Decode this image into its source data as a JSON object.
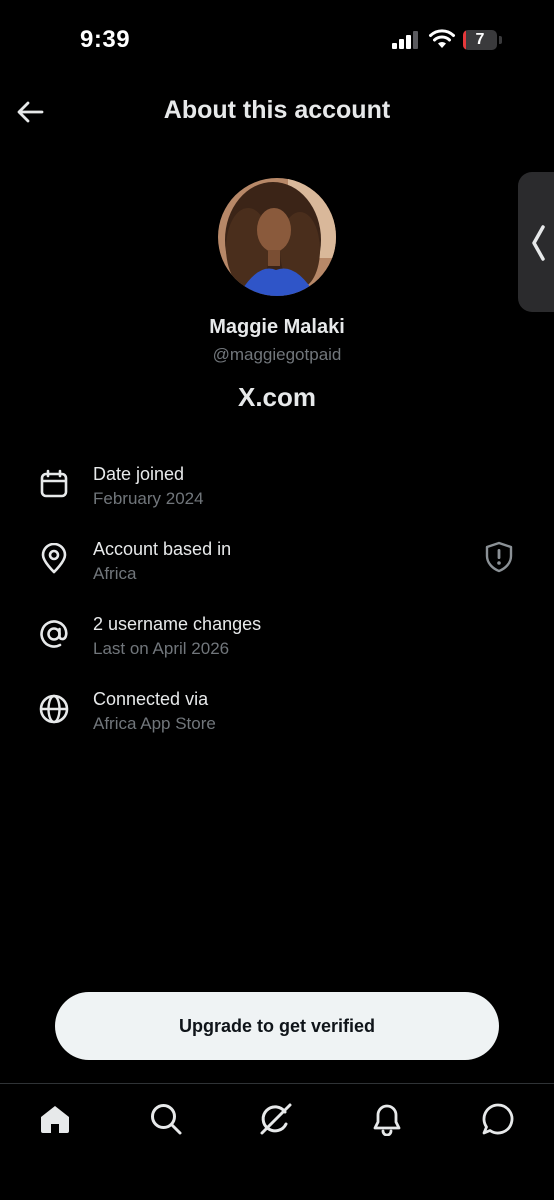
{
  "status_bar": {
    "time": "9:39",
    "battery_level": "7"
  },
  "header": {
    "title": "About this account"
  },
  "profile": {
    "display_name": "Maggie Malaki",
    "handle": "@maggiegotpaid",
    "platform": "X.com"
  },
  "info": [
    {
      "icon": "calendar-icon",
      "title": "Date joined",
      "subtitle": "February 2024"
    },
    {
      "icon": "location-pin-icon",
      "title": "Account based in",
      "subtitle": "Africa"
    },
    {
      "icon": "at-sign-icon",
      "title": "2 username changes",
      "subtitle": "Last on April 2026"
    },
    {
      "icon": "globe-icon",
      "title": "Connected via",
      "subtitle": "Africa App Store"
    }
  ],
  "cta": {
    "label": "Upgrade to get verified"
  },
  "tabs": [
    "home-icon",
    "search-icon",
    "grok-icon",
    "notifications-icon",
    "messages-icon"
  ],
  "colors": {
    "background": "#000000",
    "primary_text": "#e7e9ea",
    "secondary_text": "#71767b",
    "button_bg": "#eff3f4",
    "battery_low": "#e5383b"
  }
}
